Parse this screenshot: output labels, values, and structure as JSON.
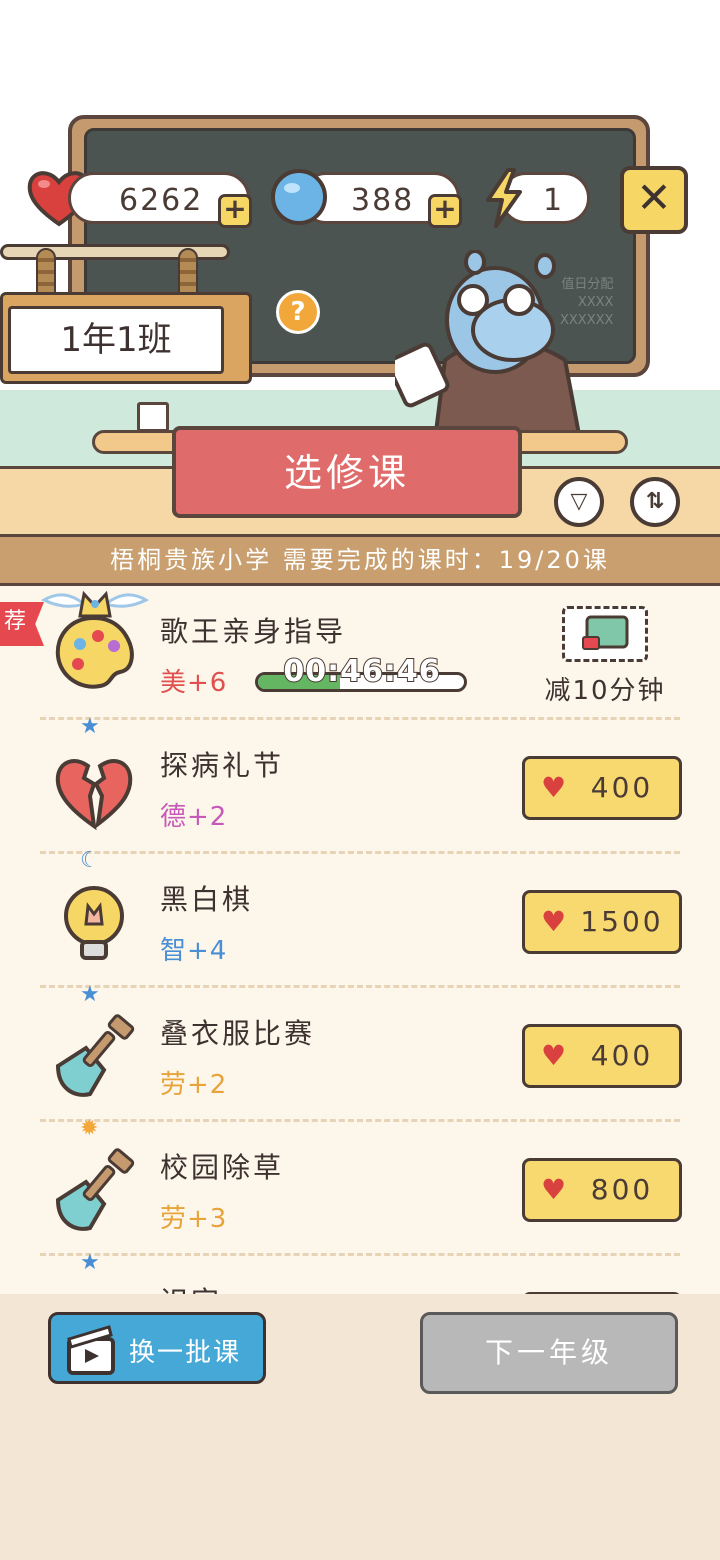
{
  "resources": {
    "hearts": "6262",
    "coins": "388",
    "energy": "1"
  },
  "class_name": "1年1班",
  "board_text": [
    "值日分配",
    "XXXX",
    "XXXXXX"
  ],
  "title": "选修课",
  "school_info": "梧桐贵族小学  需要完成的课时：19/20课",
  "recommended_tag": "荐",
  "courses": [
    {
      "name": "歌王亲身指导",
      "stat": "美+6",
      "stat_color": "#e0504f",
      "timer": "00:46:46",
      "progress": 0.4,
      "reward_label": "减10分钟"
    },
    {
      "name": "探病礼节",
      "stat": "德+2",
      "stat_color": "#c65ab8",
      "price": "400"
    },
    {
      "name": "黑白棋",
      "stat": "智+4",
      "stat_color": "#4a8fd4",
      "price": "1500"
    },
    {
      "name": "叠衣服比赛",
      "stat": "劳+2",
      "stat_color": "#e7a43a",
      "price": "400"
    },
    {
      "name": "校园除草",
      "stat": "劳+3",
      "stat_color": "#e7a43a",
      "price": "800"
    },
    {
      "name": "识字",
      "stat": "",
      "stat_color": "#4a8fd4",
      "price": ""
    }
  ],
  "buttons": {
    "swap_label": "换一批课",
    "next_grade_label": "下一年级"
  },
  "colors": {
    "accent_red": "#df6c6a",
    "button_yellow": "#f8d970",
    "swap_blue": "#46a8d6",
    "disabled_gray": "#b8b8b8"
  },
  "icons": [
    "heart-icon",
    "coin-icon",
    "lightning-icon",
    "close-icon",
    "question-icon",
    "filter-icon",
    "sort-icon",
    "video-icon",
    "coupon-icon"
  ]
}
